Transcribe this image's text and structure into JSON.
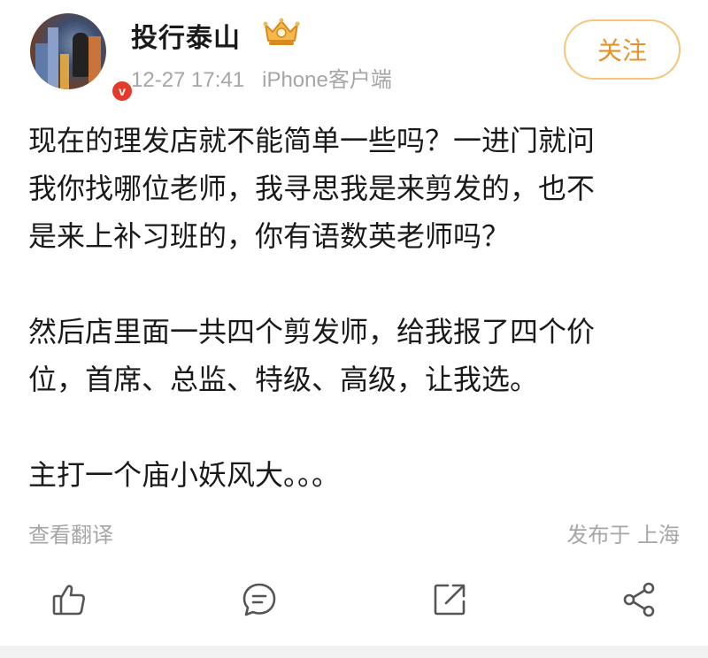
{
  "post": {
    "author": {
      "name": "投行泰山",
      "verified_badge": "v",
      "rank_icon": "crown-badge-icon"
    },
    "meta": {
      "time": "12-27 17:41",
      "source": "iPhone客户端"
    },
    "follow_label": "关注",
    "content": {
      "line1": "现在的理发店就不能简单一些吗？一进门就问",
      "line2": "我你找哪位老师，我寻思我是来剪发的，也不",
      "line3": "是来上补习班的，你有语数英老师吗？",
      "line4": "然后店里面一共四个剪发师，给我报了四个价",
      "line5": "位，首席、总监、特级、高级，让我选。",
      "line6": "主打一个庙小妖风大。。。"
    },
    "translate_label": "查看翻译",
    "location_label": "发布于 上海",
    "actions": [
      "like-icon",
      "comment-icon",
      "repost-icon",
      "share-icon"
    ]
  },
  "colors": {
    "follow_border": "#f2c77a",
    "follow_text": "#e8902a",
    "meta_text": "#a6a6a6",
    "badge_red": "#e23b2a"
  }
}
